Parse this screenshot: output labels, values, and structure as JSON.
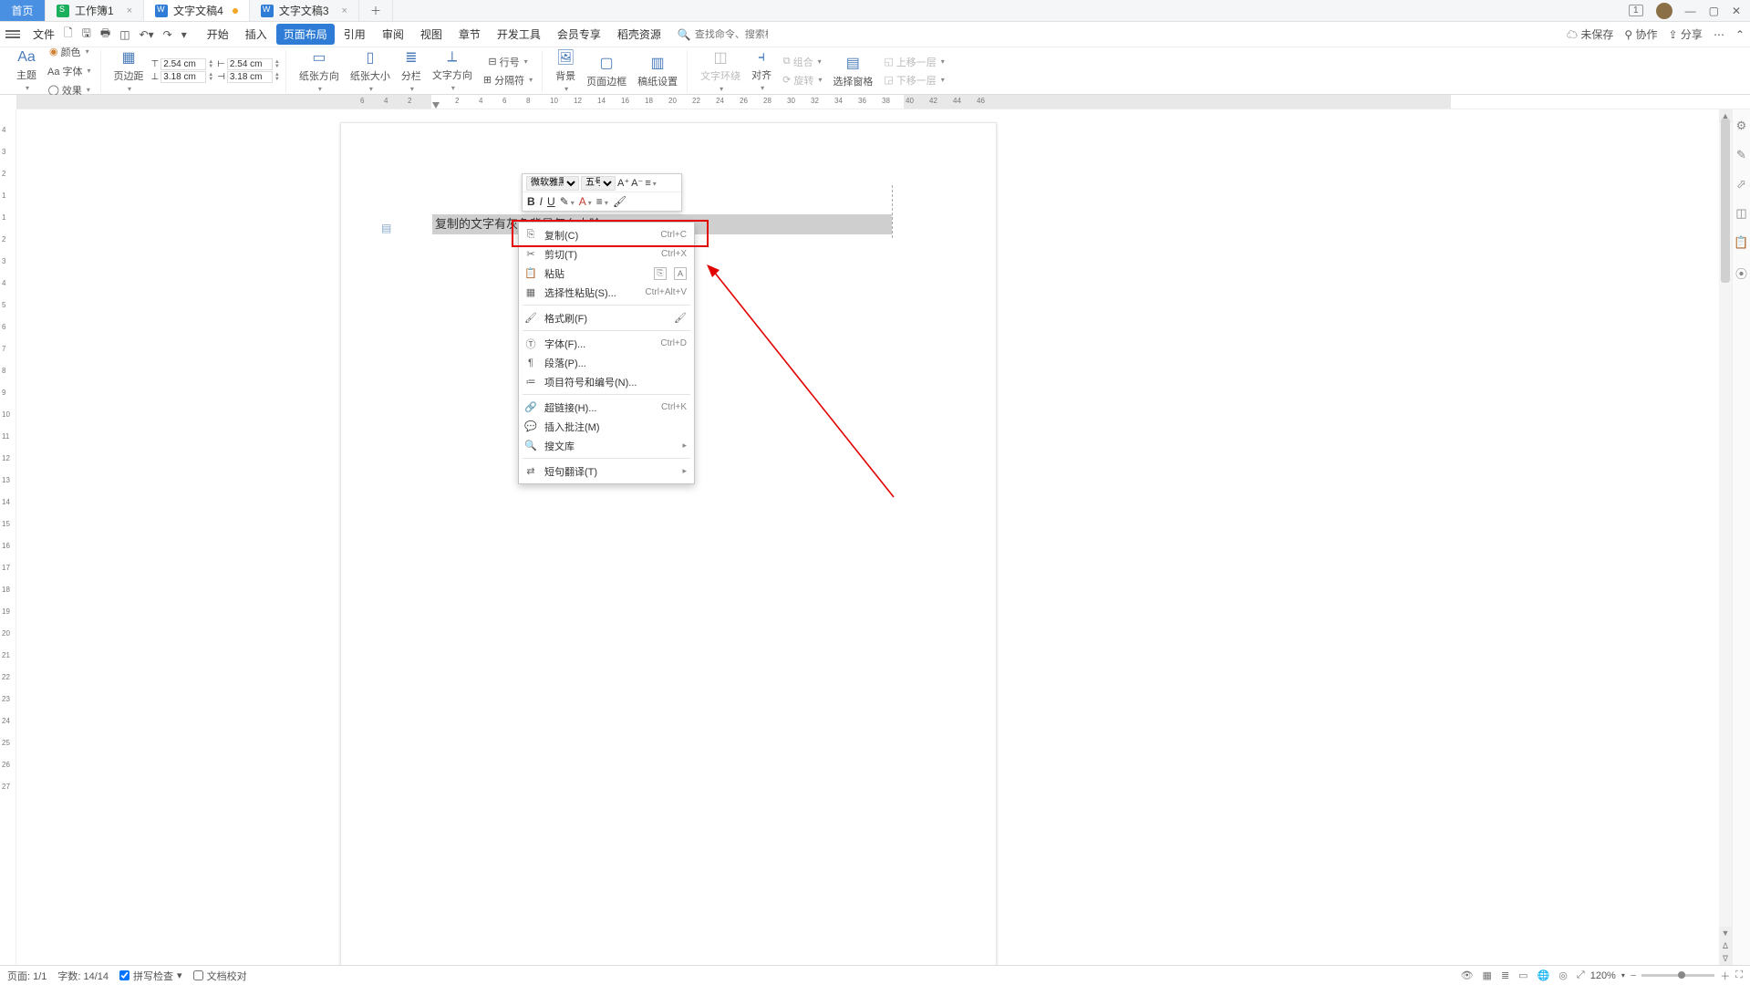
{
  "tabs": {
    "home": "首页",
    "t1": "工作簿1",
    "t2": "文字文稿4",
    "t3": "文字文稿3"
  },
  "win": {
    "badge": "1"
  },
  "menu": {
    "file": "文件",
    "items": [
      "开始",
      "插入",
      "页面布局",
      "引用",
      "审阅",
      "视图",
      "章节",
      "开发工具",
      "会员专享",
      "稻壳资源"
    ],
    "active_index": 2,
    "search_hint": "查找命令、搜索模板",
    "unsaved": "未保存",
    "collab": "协作",
    "share": "分享"
  },
  "ribbon": {
    "theme": "主题",
    "color": "颜色",
    "font": "Aa 字体",
    "effect": "效果",
    "margin": "页边距",
    "m_top": "2.54 cm",
    "m_bottom": "3.18 cm",
    "m_top2": "2.54 cm",
    "m_bottom2": "3.18 cm",
    "orient": "纸张方向",
    "size": "纸张大小",
    "columns": "分栏",
    "textdir": "文字方向",
    "lineno": "行号",
    "breaks": "分隔符",
    "bg": "背景",
    "border": "页面边框",
    "paper": "稿纸设置",
    "wrap": "文字环绕",
    "align": "对齐",
    "group": "组合",
    "rotate": "旋转",
    "selpane": "选择窗格",
    "up": "上移一层",
    "down": "下移一层"
  },
  "doc": {
    "selected_text": "复制的文字有灰色背景怎么去除"
  },
  "minitb": {
    "font": "微软雅黑",
    "size": "五号"
  },
  "ctx": {
    "copy": "复制(C)",
    "copy_sc": "Ctrl+C",
    "cut": "剪切(T)",
    "cut_sc": "Ctrl+X",
    "paste": "粘贴",
    "paste_special": "选择性粘贴(S)...",
    "ps_sc": "Ctrl+Alt+V",
    "format": "格式刷(F)",
    "font": "字体(F)...",
    "font_sc": "Ctrl+D",
    "para": "段落(P)...",
    "bullets": "项目符号和编号(N)...",
    "link": "超链接(H)...",
    "link_sc": "Ctrl+K",
    "comment": "插入批注(M)",
    "search": "搜文库",
    "translate": "短句翻译(T)"
  },
  "ruler_ticks": [
    -6,
    -4,
    -2,
    2,
    4,
    6,
    8,
    10,
    12,
    14,
    16,
    18,
    20,
    22,
    24,
    26,
    28,
    30,
    32,
    34,
    36,
    38,
    40,
    42,
    44,
    46
  ],
  "vruler_ticks": [
    -4,
    -3,
    -2,
    -1,
    1,
    2,
    3,
    4,
    5,
    6,
    7,
    8,
    9,
    10,
    11,
    12,
    13,
    14,
    15,
    16,
    17,
    18,
    19,
    20,
    21,
    22,
    23,
    24,
    25,
    26,
    27
  ],
  "status": {
    "page": "页面: 1/1",
    "words": "字数: 14/14",
    "spell": "拼写检查",
    "proof": "文档校对",
    "zoom": "120%"
  }
}
